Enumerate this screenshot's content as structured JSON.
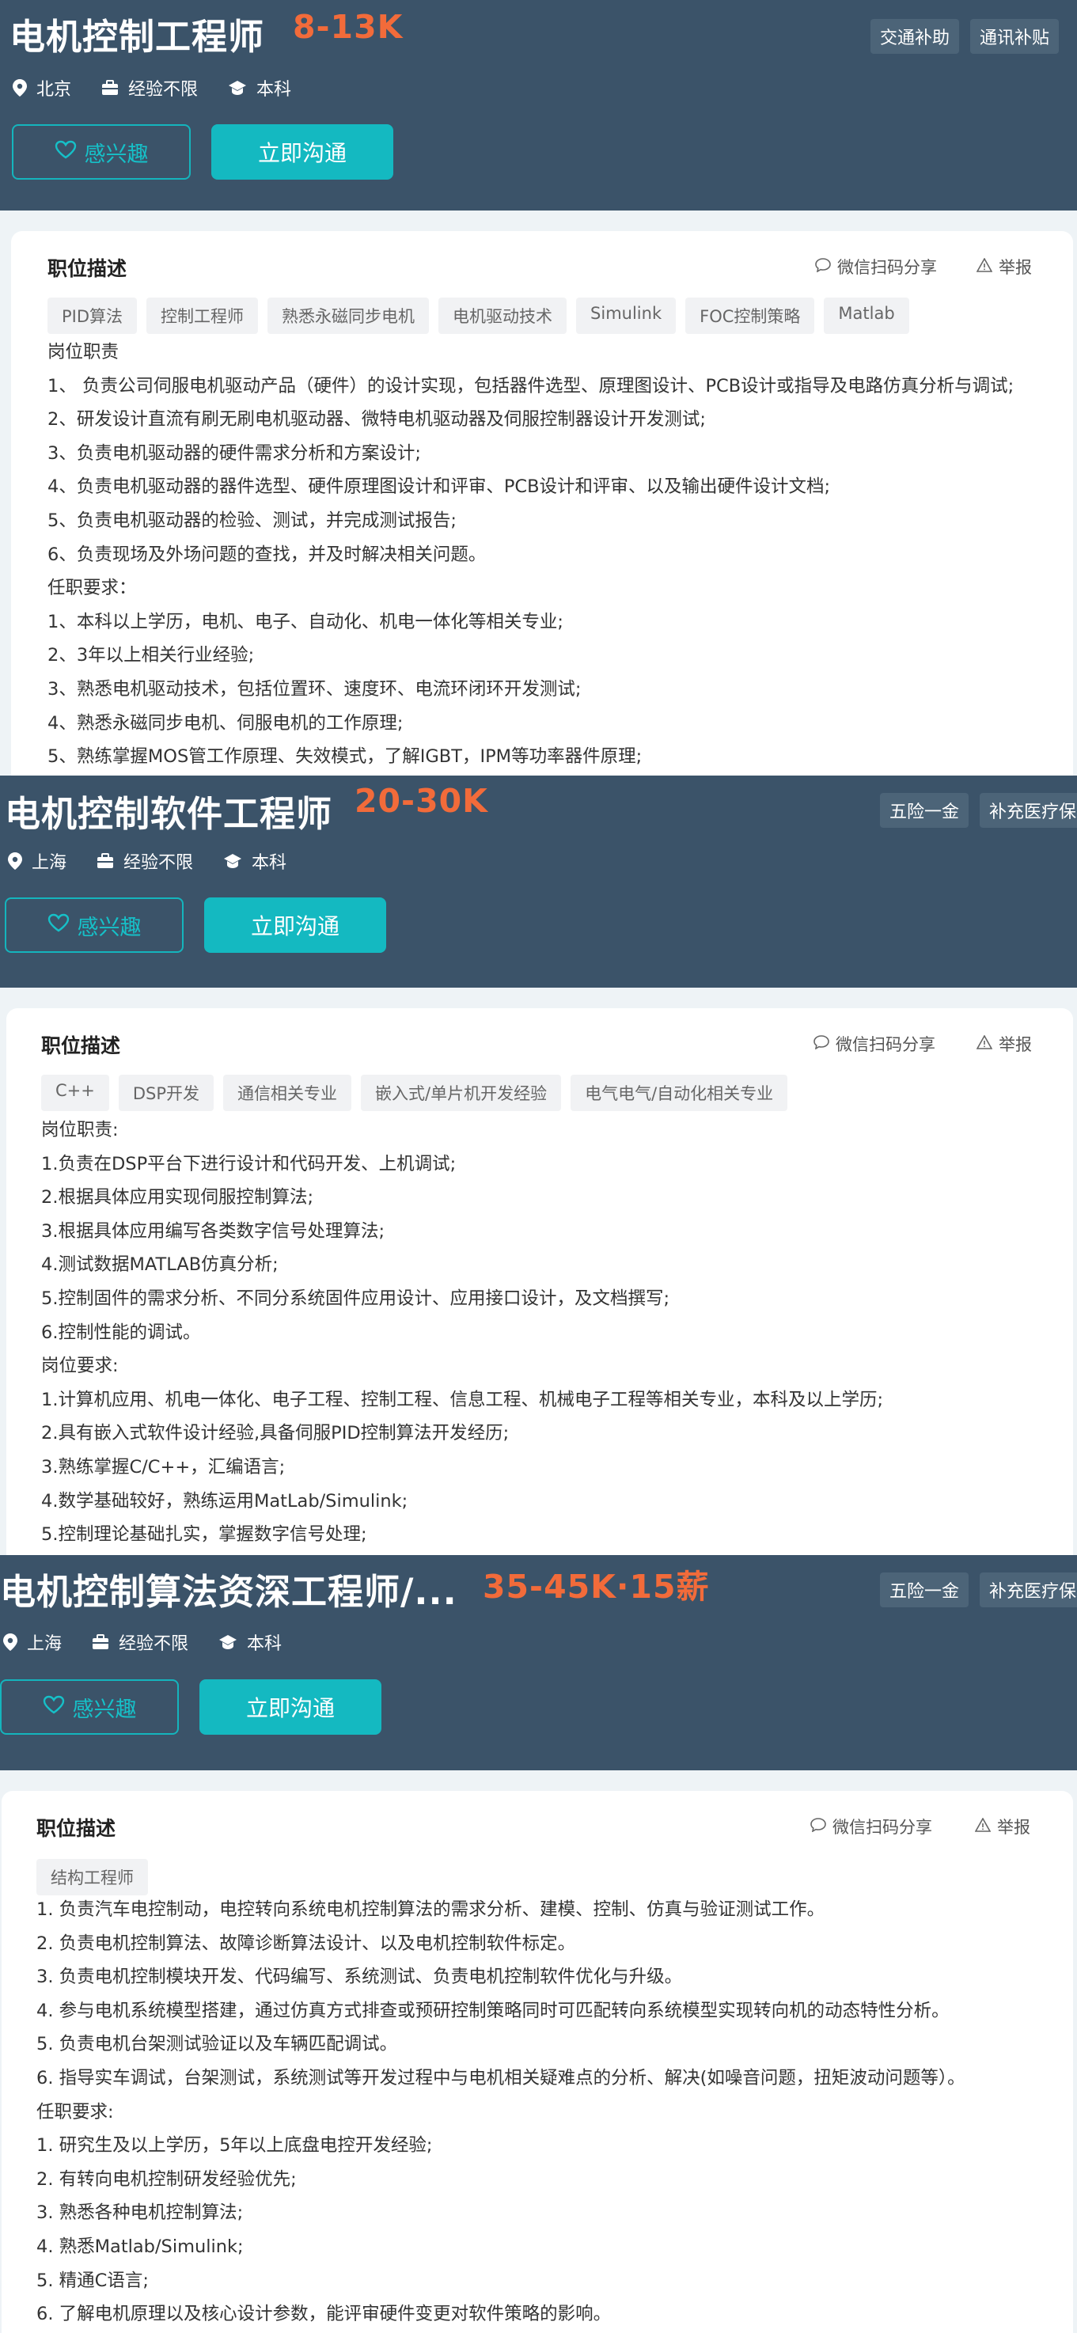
{
  "labels": {
    "interested": "感兴趣",
    "chat": "立即沟通",
    "desc_title": "职位描述",
    "share": "微信扫码分享",
    "report": "举报"
  },
  "colors": {
    "header_bg": "#3b5369",
    "salary": "#f26b3a",
    "accent": "#14b9c1",
    "band_bg": "#eef3f6"
  },
  "icons": {
    "location": "location-pin-icon",
    "experience": "briefcase-icon",
    "education": "graduation-cap-icon",
    "heart": "heart-icon",
    "share": "chat-bubble-icon",
    "report": "warning-triangle-icon"
  },
  "jobs": [
    {
      "title": "电机控制工程师",
      "salary": "8-13K",
      "benefits": [
        "交通补助",
        "通讯补贴"
      ],
      "city": "北京",
      "experience": "经验不限",
      "education": "本科",
      "tags": [
        "PID算法",
        "控制工程师",
        "熟悉永磁同步电机",
        "电机驱动技术",
        "Simulink",
        "FOC控制策略",
        "Matlab"
      ],
      "lines": [
        "岗位职责",
        "1、 负责公司伺服电机驱动产品（硬件）的设计实现，包括器件选型、原理图设计、PCB设计或指导及电路仿真分析与调试;",
        "2、研发设计直流有刷无刷电机驱动器、微特电机驱动器及伺服控制器设计开发测试;",
        "3、负责电机驱动器的硬件需求分析和方案设计;",
        "4、负责电机驱动器的器件选型、硬件原理图设计和评审、PCB设计和评审、以及输出硬件设计文档;",
        "5、负责电机驱动器的检验、测试，并完成测试报告;",
        "6、负责现场及外场问题的查找，并及时解决相关问题。",
        "任职要求：",
        "1、本科以上学历，电机、电子、自动化、机电一体化等相关专业;",
        "2、3年以上相关行业经验;",
        "3、熟悉电机驱动技术，包括位置环、速度环、电流环闭环开发测试;",
        "4、熟悉永磁同步电机、伺服电机的工作原理;",
        "5、熟练掌握MOS管工作原理、失效模式，了解IGBT，IPM等功率器件原理;"
      ]
    },
    {
      "title": "电机控制软件工程师",
      "salary": "20-30K",
      "benefits": [
        "五险一金",
        "补充医疗保险"
      ],
      "city": "上海",
      "experience": "经验不限",
      "education": "本科",
      "tags": [
        "C++",
        "DSP开发",
        "通信相关专业",
        "嵌入式/单片机开发经验",
        "电气电气/自动化相关专业"
      ],
      "lines": [
        "岗位职责:",
        "1.负责在DSP平台下进行设计和代码开发、上机调试;",
        "2.根据具体应用实现伺服控制算法;",
        "3.根据具体应用编写各类数字信号处理算法;",
        "4.测试数据MATLAB仿真分析;",
        "5.控制固件的需求分析、不同分系统固件应用设计、应用接口设计，及文档撰写;",
        "6.控制性能的调试。",
        "岗位要求:",
        "1.计算机应用、机电一体化、电子工程、控制工程、信息工程、机械电子工程等相关专业，本科及以上学历;",
        "2.具有嵌入式软件设计经验,具备伺服PID控制算法开发经历;",
        "3.熟练掌握C/C++，汇编语言;",
        "4.数学基础较好，熟练运用MatLab/Simulink;",
        "5.控制理论基础扎实，掌握数字信号处理;"
      ]
    },
    {
      "title": "电机控制算法资深工程师/...",
      "salary": "35-45K·15薪",
      "benefits": [
        "五险一金",
        "补充医疗保险"
      ],
      "city": "上海",
      "experience": "经验不限",
      "education": "本科",
      "tags": [
        "结构工程师"
      ],
      "lines": [
        "1. 负责汽车电控制动，电控转向系统电机控制算法的需求分析、建模、控制、仿真与验证测试工作。",
        "2. 负责电机控制算法、故障诊断算法设计、以及电机控制软件标定。",
        "3. 负责电机控制模块开发、代码编写、系统测试、负责电机控制软件优化与升级。",
        "4. 参与电机系统模型搭建，通过仿真方式排查或预研控制策略同时可匹配转向系统模型实现转向机的动态特性分析。",
        "5. 负责电机台架测试验证以及车辆匹配调试。",
        "6. 指导实车调试，台架测试，系统测试等开发过程中与电机相关疑难点的分析、解决(如噪音问题，扭矩波动问题等）。",
        "任职要求:",
        "1. 研究生及以上学历，5年以上底盘电控开发经验;",
        "2. 有转向电机控制研发经验优先;",
        "3. 熟悉各种电机控制算法;",
        "4. 熟悉Matlab/Simulink;",
        "5. 精通C语言;",
        "6. 了解电机原理以及核心设计参数，能评审硬件变更对软件策略的影响。"
      ]
    }
  ]
}
